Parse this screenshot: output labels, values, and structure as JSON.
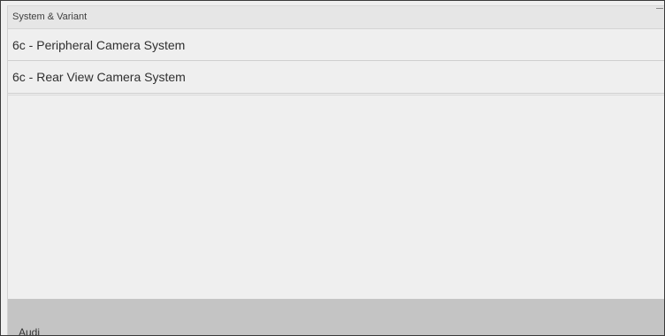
{
  "header": {
    "title": "System & Variant"
  },
  "list": {
    "items": [
      {
        "label": "6c - Peripheral Camera System"
      },
      {
        "label": "6c - Rear View Camera System"
      }
    ]
  },
  "footer": {
    "brand": "Audi"
  }
}
